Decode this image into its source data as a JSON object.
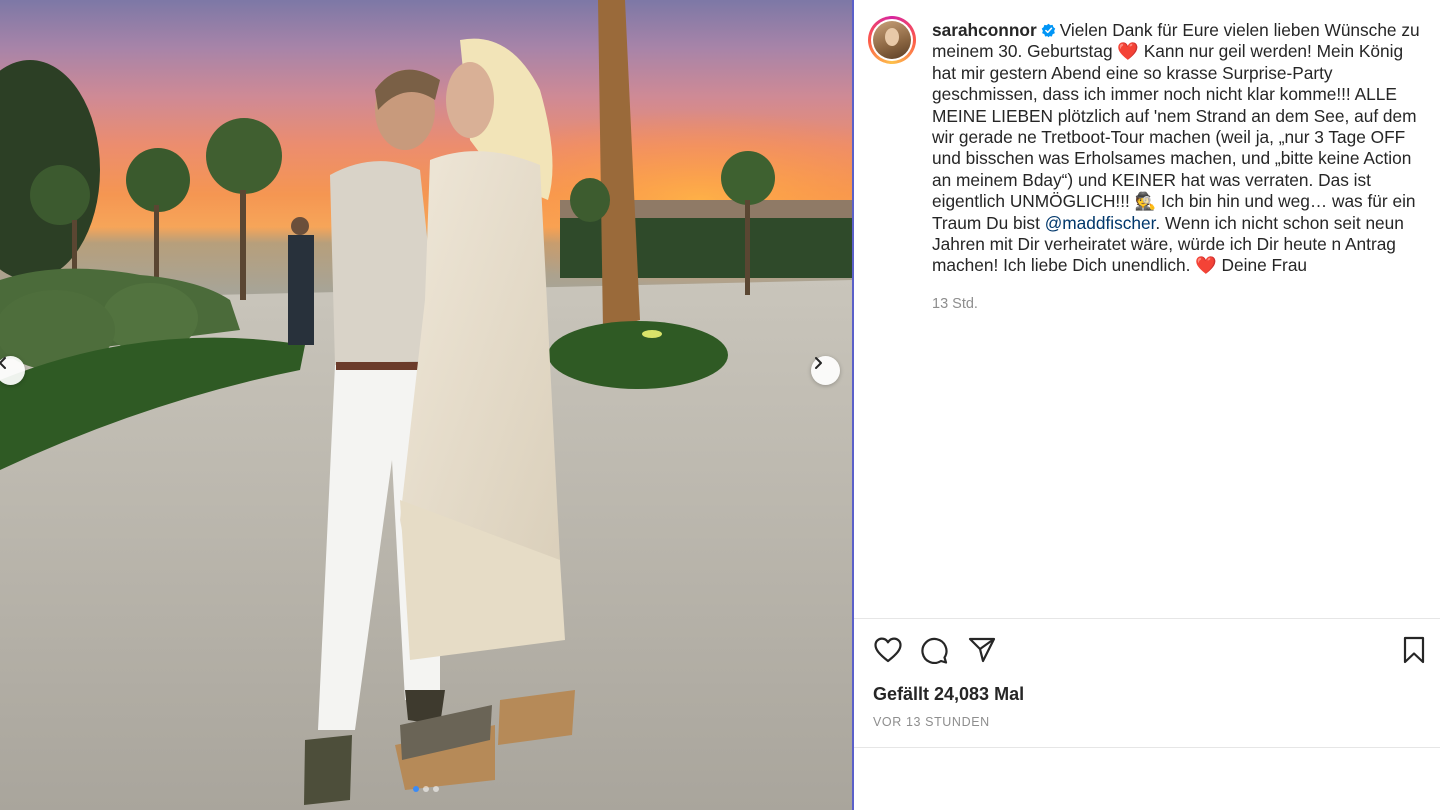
{
  "post": {
    "photo_alt": "",
    "carousel": {
      "dots": 3,
      "active_dot": 0
    }
  },
  "profile": {
    "username": "sarahconnor",
    "verified": true
  },
  "caption": {
    "text_part1": "Vielen Dank für Eure vielen lieben Wünsche zu meinem 30. Geburtstag ",
    "text_part2": " Kann nur geil werden! Mein König hat mir gestern Abend eine so krasse Surprise-Party geschmissen, dass ich immer noch nicht klar komme!!! ALLE MEINE LIEBEN plötzlich auf 'nem Strand an dem See, auf dem wir gerade ne Tretboot-Tour machen (weil ja, „nur 3 Tage OFF und bisschen was Erholsames machen, und „bitte keine Action an meinem Bday“) und KEINER hat was verraten. Das ist eigentlich UNMÖGLICH!!! ",
    "text_part3": " Ich bin hin und weg… was für ein Traum Du bist ",
    "mention": "@maddfischer",
    "text_part4": ". Wenn ich nicht schon seit neun Jahren mit Dir verheiratet wäre, würde ich Dir heute n Antrag machen! Ich liebe Dich unendlich. ",
    "text_part5": " Deine Frau",
    "emoji_heart": "❤️",
    "emoji_detective": "🕵"
  },
  "timestamp_short": "13 Std.",
  "likes": "Gefällt 24,083 Mal",
  "posted_ago": "VOR 13 STUNDEN",
  "icons": {
    "like": "heart-icon",
    "comment": "comment-icon",
    "share": "send-icon",
    "save": "bookmark-icon",
    "prev": "chevron-left-icon",
    "next": "chevron-right-icon",
    "verified": "verified-badge-icon"
  },
  "colors": {
    "text": "#262626",
    "secondary": "#8e8e8e",
    "mention": "#00376b",
    "verified": "#0095f6",
    "heart": "#ed1c24"
  }
}
